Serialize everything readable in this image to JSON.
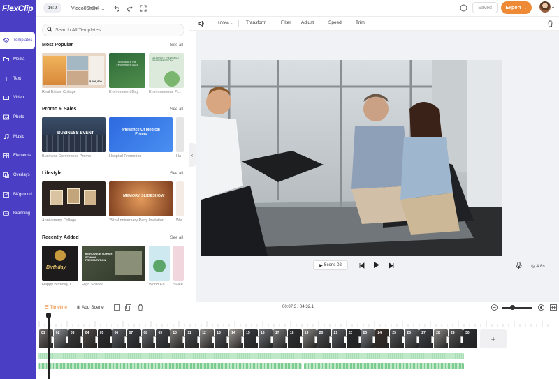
{
  "app": {
    "logo": "FlexClip",
    "project_name": "Video06國民 ...",
    "ratio": "16:9",
    "saved_label": "Saved",
    "export_label": "Export →"
  },
  "sidebar": {
    "items": [
      {
        "label": "Templates",
        "icon": "templates-icon"
      },
      {
        "label": "Media",
        "icon": "folder-icon"
      },
      {
        "label": "Text",
        "icon": "text-icon"
      },
      {
        "label": "Video",
        "icon": "video-icon"
      },
      {
        "label": "Photo",
        "icon": "photo-icon"
      },
      {
        "label": "Music",
        "icon": "music-icon"
      },
      {
        "label": "Elements",
        "icon": "elements-icon"
      },
      {
        "label": "Overlays",
        "icon": "overlays-icon"
      },
      {
        "label": "BKground",
        "icon": "background-icon"
      },
      {
        "label": "Branding",
        "icon": "branding-icon"
      }
    ]
  },
  "search": {
    "placeholder": "Search All Templates"
  },
  "sections": [
    {
      "title": "Most Popular",
      "see_all": "See all",
      "items": [
        "Real Estate Collage",
        "Environment Day",
        "Environmental Pr..."
      ]
    },
    {
      "title": "Promo & Sales",
      "see_all": "See all",
      "items": [
        "Business Conference Promo",
        "Hospital Promotion",
        "Ha"
      ]
    },
    {
      "title": "Lifestyle",
      "see_all": "See all",
      "items": [
        "Anniversary Collage",
        "25th Anniversary Party Invitation",
        "We"
      ]
    },
    {
      "title": "Recently Added",
      "see_all": "See all",
      "items": [
        "Happy Birthday T...",
        "High School",
        "World En...",
        "Swee"
      ]
    }
  ],
  "thumb_text": {
    "real_estate_price": "$ 499,800",
    "env_day_text": "CELEBRATE THE ENVIRONMENT DAY",
    "env_pr_text": "CELEBRATE THE WORLD ENVIRONMENT DAY",
    "business_event": "BUSINESS EVENT",
    "medical_promo": "Presence Of Medical Promo",
    "memory_slideshow": "MEMORY SLIDESHOW",
    "birthday": "Birthday",
    "high_school": "INTRODUCE TO HIGH SCHOOL PRESENTATION"
  },
  "edit_toolbar": {
    "zoom": "100%",
    "transform": "Transform",
    "filter": "Filter",
    "adjust": "Adjust",
    "speed": "Speed",
    "trim": "Trim"
  },
  "preview": {
    "scene": "Scene 02",
    "duration": "4.8s"
  },
  "timeline": {
    "label": "Timeline",
    "add_scene": "Add Scene",
    "time": "00:07.3 / 04:32.1"
  },
  "clips": [
    {
      "num": "01",
      "color": "#6f6a66"
    },
    {
      "num": "02",
      "color": "#8c8f93"
    },
    {
      "num": "03",
      "color": "#3b3b3d"
    },
    {
      "num": "04",
      "color": "#4f4a46"
    },
    {
      "num": "05",
      "color": "#2d2d30"
    },
    {
      "num": "06",
      "color": "#5b5f66"
    },
    {
      "num": "07",
      "color": "#3a3c41"
    },
    {
      "num": "08",
      "color": "#6c6e72"
    },
    {
      "num": "09",
      "color": "#43464b"
    },
    {
      "num": "10",
      "color": "#7c7a76"
    },
    {
      "num": "11",
      "color": "#4d4f52"
    },
    {
      "num": "12",
      "color": "#8a8783"
    },
    {
      "num": "13",
      "color": "#55585d"
    },
    {
      "num": "14",
      "color": "#9a9690"
    },
    {
      "num": "15",
      "color": "#393b3f"
    },
    {
      "num": "16",
      "color": "#6e7277"
    },
    {
      "num": "17",
      "color": "#777"
    },
    {
      "num": "18",
      "color": "#2f3032"
    },
    {
      "num": "19",
      "color": "#8c8985"
    },
    {
      "num": "20",
      "color": "#4e4f53"
    },
    {
      "num": "21",
      "color": "#5d6066"
    },
    {
      "num": "22",
      "color": "#26282b"
    },
    {
      "num": "23",
      "color": "#7a7d82"
    },
    {
      "num": "24",
      "color": "#3a2f29"
    },
    {
      "num": "25",
      "color": "#545659"
    },
    {
      "num": "26",
      "color": "#6a6c70"
    },
    {
      "num": "27",
      "color": "#41434a"
    },
    {
      "num": "28",
      "color": "#8d8a86"
    },
    {
      "num": "29",
      "color": "#555"
    },
    {
      "num": "30",
      "color": "#2c2e31"
    }
  ]
}
